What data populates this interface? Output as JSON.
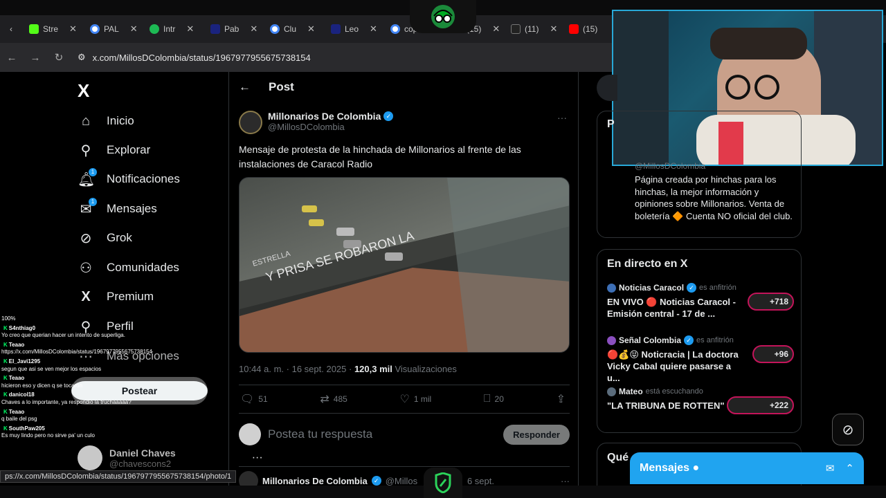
{
  "browser": {
    "tabs": [
      {
        "label": "Stre",
        "color": "#53fc18"
      },
      {
        "label": "PAL",
        "color": "#4285f4"
      },
      {
        "label": "Intr",
        "color": "#1db954"
      },
      {
        "label": "Pab",
        "color": "#1a237e"
      },
      {
        "label": "Clu",
        "color": "#4285f4"
      },
      {
        "label": "Leo",
        "color": "#1a237e"
      },
      {
        "label": "cop",
        "color": "#4285f4"
      },
      {
        "label": "(15)",
        "color": "#777777"
      },
      {
        "label": "(11)",
        "color": "#222222"
      },
      {
        "label": "(15)",
        "color": "#ff0000"
      }
    ],
    "url": "x.com/MillosDColombia/status/1967977955675738154"
  },
  "nav": {
    "logo": "X",
    "items": [
      {
        "label": "Inicio",
        "icon": "⌂"
      },
      {
        "label": "Explorar",
        "icon": "⚲"
      },
      {
        "label": "Notificaciones",
        "icon": "🔔︎",
        "badge": "1"
      },
      {
        "label": "Mensajes",
        "icon": "✉",
        "badge": "1"
      },
      {
        "label": "Grok",
        "icon": "⊘"
      },
      {
        "label": "Comunidades",
        "icon": "⚇"
      },
      {
        "label": "Premium",
        "icon": "X"
      },
      {
        "label": "Perfil",
        "icon": "⚲"
      },
      {
        "label": "Más opciones",
        "icon": "⋯"
      }
    ],
    "post_button": "Postear",
    "user": {
      "name": "Daniel Chaves",
      "handle": "@chavescons2"
    }
  },
  "chat": [
    {
      "user": "",
      "msg": "100%"
    },
    {
      "user": "S4nthiag0",
      "msg": "Yo creo que querian hacer un intento de superliga."
    },
    {
      "user": "Teaao",
      "msg": "https://x.com/MillosDColombia/status/1967977955675738154"
    },
    {
      "user": "El_Javi1295",
      "msg": "segun que asi se ven mejor los espacios"
    },
    {
      "user": "Teaao",
      "msg": "hicieron eso y dicen q se tocaron"
    },
    {
      "user": "danicol18",
      "msg": "Chaves a lo importante, ya respondió la truchaaaaa?"
    },
    {
      "user": "Teaao",
      "msg": "q baile del psg"
    },
    {
      "user": "SouthPaw205",
      "msg": "Es muy lindo pero no sirve pa' un culo"
    }
  ],
  "post": {
    "header": "Post",
    "back_icon": "←",
    "author_name": "Millonarios De Colombia",
    "author_handle": "@MillosDColombia",
    "text": "Mensaje de protesta de la hinchada de Millonarios al frente de las instalaciones de Caracol Radio",
    "media_text_1": "Y PRISA SE ROBARON LA",
    "media_text_2": "ESTRELLA",
    "time": "10:44 a. m. · 16 sept. 2025 · ",
    "views": "120,3 mil",
    "views_label": " Visualizaciones",
    "replies": "51",
    "reposts": "485",
    "likes": "1 mil",
    "bookmarks": "20",
    "reply_placeholder": "Postea tu respuesta",
    "reply_button": "Responder",
    "next_author": "Millonarios De Colombia",
    "next_handle": "@Millos",
    "next_date": "6 sept.",
    "status_url": "ps://x.com/MillosDColombia/status/1967977955675738154/photo/1"
  },
  "sidebar": {
    "profile_handle": "@MillosDColombia",
    "profile_initial": "P",
    "bio": "Página creada por hinchas para los hinchas, la mejor información y opiniones sobre Millonarios. Venta de boletería 🔶 Cuenta NO oficial del club.",
    "live_title": "En directo en X",
    "live": [
      {
        "host": "Noticias Caracol",
        "role": "es anfitrión",
        "title": "EN VIVO 🔴 Noticias Caracol - Emisión central - 17 de ...",
        "count": "+718",
        "pfp": "#3d6fb6"
      },
      {
        "host": "Señal Colombia",
        "role": "es anfitrión",
        "title": "🔴💰😝 Noticracia | La doctora Vicky Cabal quiere pasarse a u...",
        "count": "+96",
        "pfp": "#8a4fbf"
      },
      {
        "host": "Mateo",
        "role": "está escuchando",
        "title": "\"LA TRIBUNA DE ROTTEN\"",
        "count": "+222",
        "pfp": "#5b6c7c"
      }
    ],
    "que_title": "Qué",
    "messages_title": "Mensajes"
  },
  "colors": {
    "accent": "#1d9bf0",
    "live_ring": "#c4145a"
  }
}
